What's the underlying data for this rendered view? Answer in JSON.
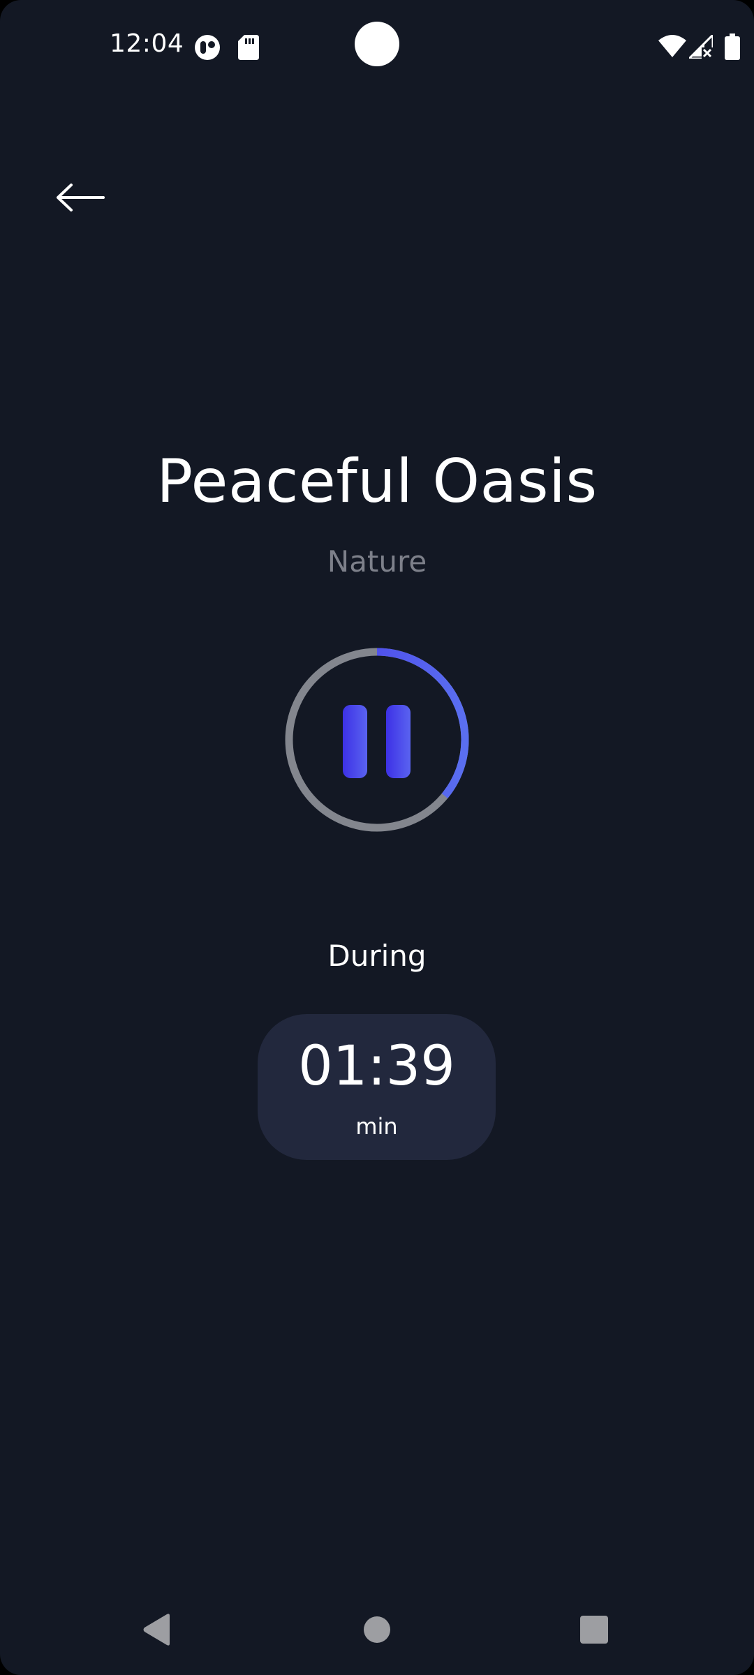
{
  "status_bar": {
    "time": "12:04",
    "icons": [
      "app-notification-icon",
      "sd-card-icon",
      "wifi-icon",
      "cellular-no-signal-icon",
      "battery-icon"
    ]
  },
  "header": {
    "back_icon": "arrow-left-icon"
  },
  "track": {
    "title": "Peaceful Oasis",
    "category": "Nature"
  },
  "player": {
    "state_icon": "pause-icon",
    "progress_fraction": 0.36,
    "colors": {
      "track_ring": "#83868e",
      "progress_start": "#4634e8",
      "progress_end": "#5a6ff0"
    }
  },
  "duration": {
    "label": "During",
    "value": "01:39",
    "unit": "min"
  },
  "nav_bar": {
    "icons": [
      "back-triangle-icon",
      "home-circle-icon",
      "recents-square-icon"
    ]
  },
  "colors": {
    "background": "#131824",
    "card": "#22283d",
    "muted_text": "#7d808a"
  }
}
